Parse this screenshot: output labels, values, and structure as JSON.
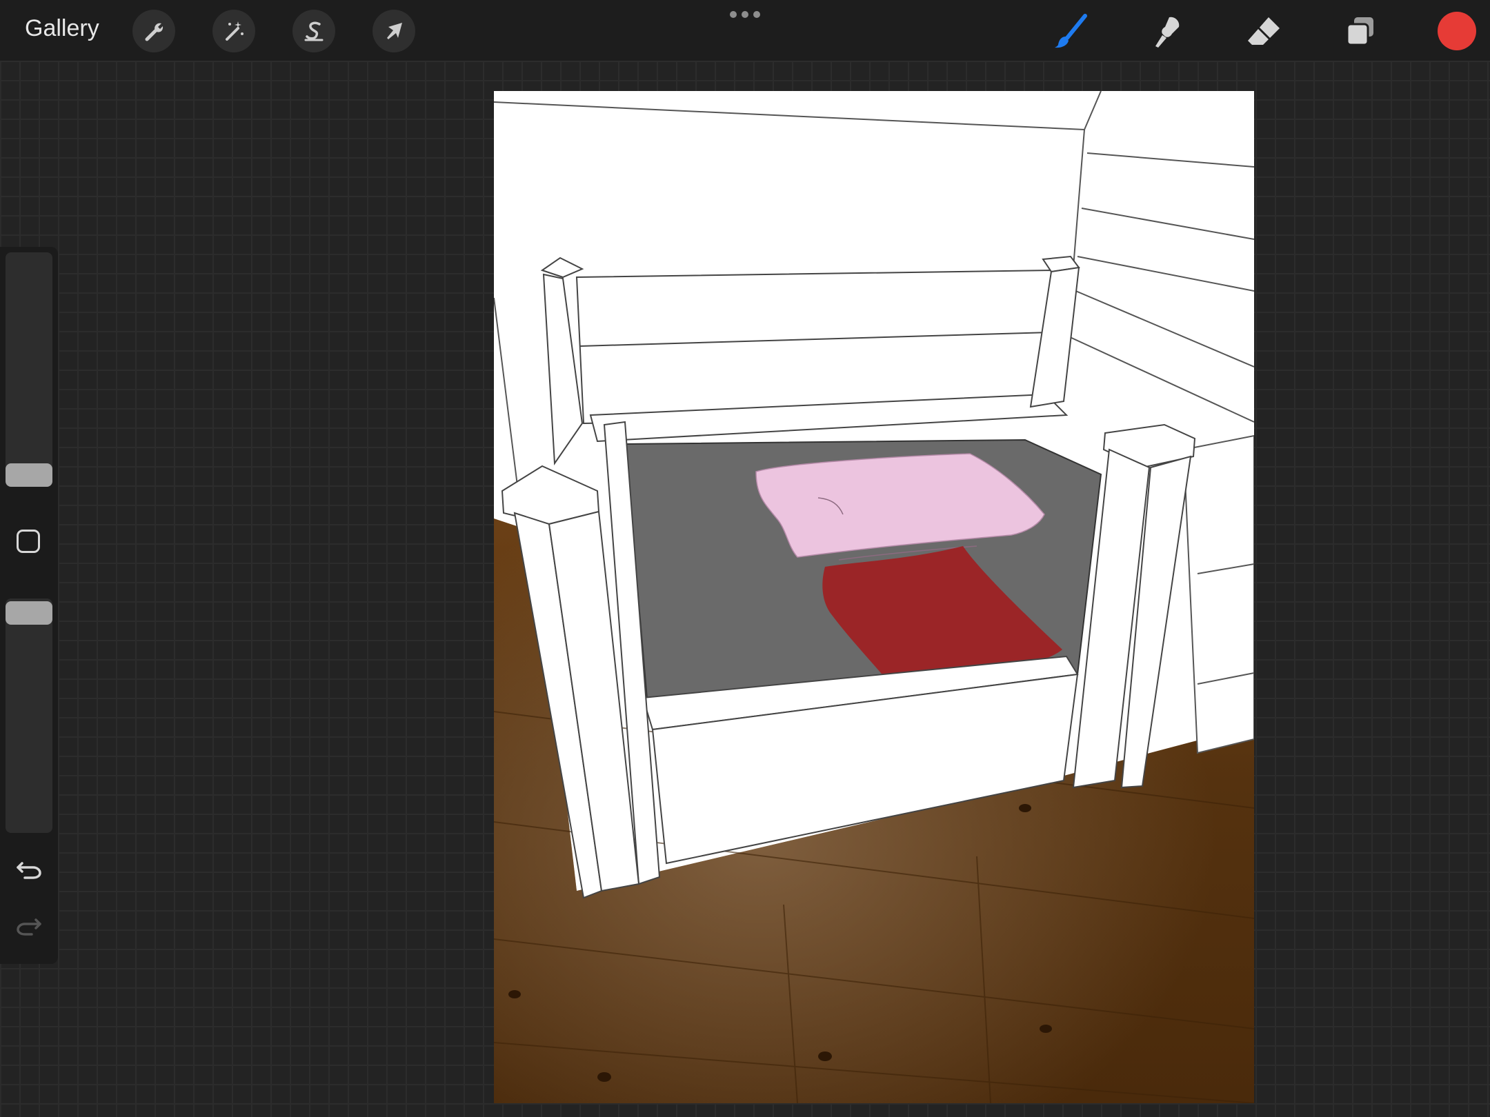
{
  "topbar": {
    "gallery_label": "Gallery",
    "left_tools": [
      {
        "name": "actions",
        "icon": "wrench-icon"
      },
      {
        "name": "adjustments",
        "icon": "magic-wand-icon"
      },
      {
        "name": "selection",
        "icon": "selection-s-icon"
      },
      {
        "name": "transform",
        "icon": "arrow-cursor-icon"
      }
    ],
    "menu_icon": "more-dots-icon",
    "right_tools": [
      {
        "name": "brush",
        "icon": "brush-icon",
        "active": true
      },
      {
        "name": "smudge",
        "icon": "smudge-icon",
        "active": false
      },
      {
        "name": "eraser",
        "icon": "eraser-icon",
        "active": false
      },
      {
        "name": "layers",
        "icon": "layers-icon",
        "active": false
      }
    ],
    "current_color": "#e63b36",
    "active_tool_color": "#1e7bf0"
  },
  "sidebar": {
    "brush_size_icon": "size-slider-icon",
    "modify_icon": "square-modify-icon",
    "opacity_icon": "opacity-slider-icon",
    "undo_icon": "undo-icon",
    "redo_icon": "redo-icon"
  },
  "canvas": {
    "description_colors": {
      "wall": "#ffffff",
      "seat": "#6a6a6a",
      "floor": "#5a3511",
      "pink_pillow": "#ecc4df",
      "red_pillow": "#9b2527"
    }
  }
}
